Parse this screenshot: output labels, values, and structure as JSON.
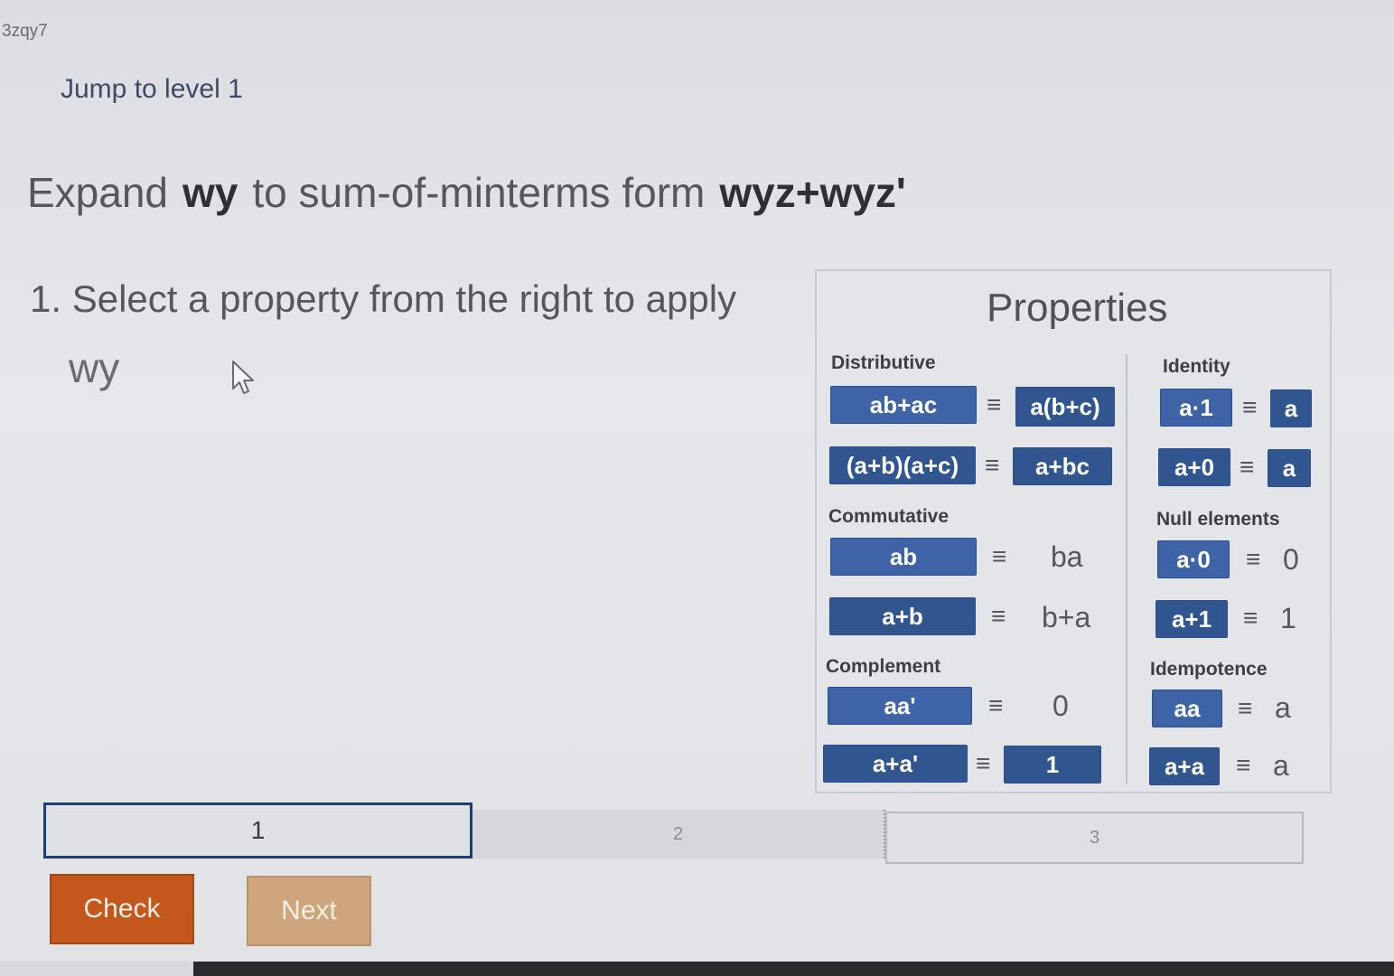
{
  "activity_id": "3zqy7",
  "jump_link": "Jump to level 1",
  "heading": {
    "prefix": "Expand",
    "expr": "wy",
    "middle": "to sum-of-minterms form",
    "target": "wyz+wyz'"
  },
  "instruction": "1. Select a property from the right to apply",
  "current_expression": "wy",
  "properties": {
    "title": "Properties",
    "equiv": "≡",
    "distributive": {
      "label": "Distributive",
      "rows": [
        {
          "left": "ab+ac",
          "right": "a(b+c)"
        },
        {
          "left": "(a+b)(a+c)",
          "right": "a+bc"
        }
      ]
    },
    "commutative": {
      "label": "Commutative",
      "rows": [
        {
          "left": "ab",
          "right": "ba"
        },
        {
          "left": "a+b",
          "right": "b+a"
        }
      ]
    },
    "complement": {
      "label": "Complement",
      "rows": [
        {
          "left": "aa'",
          "right": "0"
        },
        {
          "left": "a+a'",
          "right": "1"
        }
      ]
    },
    "identity": {
      "label": "Identity",
      "rows": [
        {
          "left": "a·1",
          "right": "a"
        },
        {
          "left": "a+0",
          "right": "a"
        }
      ]
    },
    "null_elements": {
      "label": "Null elements",
      "rows": [
        {
          "left": "a·0",
          "right": "0"
        },
        {
          "left": "a+1",
          "right": "1"
        }
      ]
    },
    "idempotence": {
      "label": "Idempotence",
      "rows": [
        {
          "left": "aa",
          "right": "a"
        },
        {
          "left": "a+a",
          "right": "a"
        }
      ]
    }
  },
  "progress": {
    "steps": [
      "1",
      "2",
      "3"
    ],
    "current": 1
  },
  "buttons": {
    "check": "Check",
    "next": "Next"
  }
}
